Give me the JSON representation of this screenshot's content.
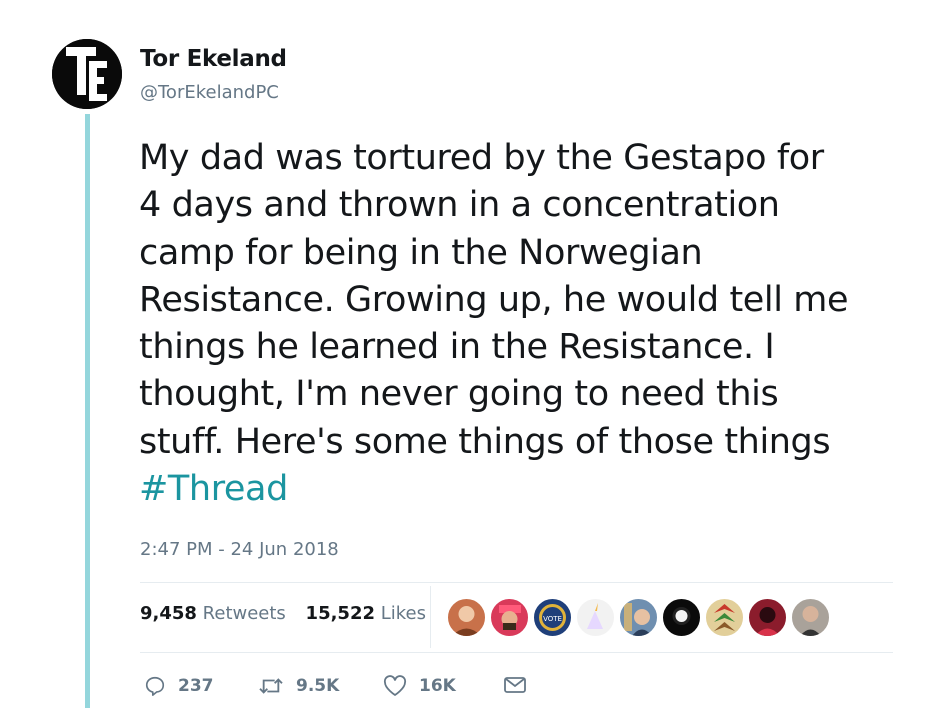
{
  "author": {
    "display_name": "Tor Ekeland",
    "handle": "@TorEkelandPC",
    "avatar_icon": "te-logo-avatar"
  },
  "tweet": {
    "lines": [
      "My dad was tortured by the Gestapo for",
      "4 days and thrown in a concentration",
      "camp for being in the Norwegian",
      "Resistance. Growing up, he would tell me",
      "things he learned in the Resistance. I",
      "thought, I'm never going to need this",
      "stuff. Here's some things of those things"
    ],
    "hashtag": "#Thread",
    "timestamp": "2:47 PM - 24 Jun 2018"
  },
  "stats": {
    "retweets_count": "9,458",
    "retweets_label": "Retweets",
    "likes_count": "15,522",
    "likes_label": "Likes"
  },
  "likers": [
    {
      "name": "liker-avatar-1",
      "color": "#c8714a"
    },
    {
      "name": "liker-avatar-2",
      "color": "#d93a5a"
    },
    {
      "name": "liker-avatar-3",
      "color": "#1f3f7a"
    },
    {
      "name": "liker-avatar-4",
      "color": "#f2f2f2"
    },
    {
      "name": "liker-avatar-5",
      "color": "#6f8fb0"
    },
    {
      "name": "liker-avatar-6",
      "color": "#0b0b0b"
    },
    {
      "name": "liker-avatar-7",
      "color": "#e2cf9a"
    },
    {
      "name": "liker-avatar-8",
      "color": "#8b1c2c"
    },
    {
      "name": "liker-avatar-9",
      "color": "#a9a29a"
    }
  ],
  "actions": {
    "reply_count": "237",
    "retweet_count": "9.5K",
    "like_count": "16K"
  },
  "colors": {
    "accent": "#1b95a0",
    "thread_line": "#94d6dc",
    "muted": "#657786"
  }
}
